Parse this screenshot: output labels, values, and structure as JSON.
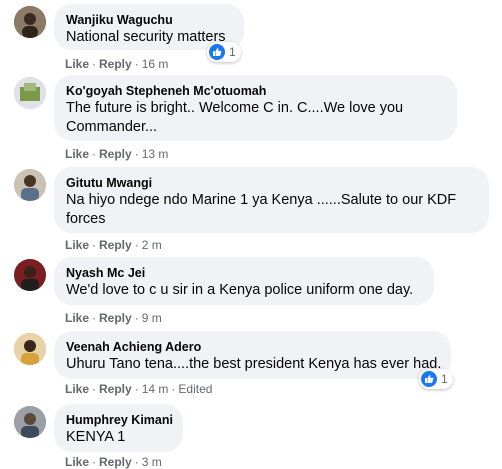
{
  "colors": {
    "bubble": "#f0f2f5",
    "meta": "#65676b",
    "like_blue": "#1877f2"
  },
  "actions": {
    "like": "Like",
    "reply": "Reply",
    "dot": "·"
  },
  "comments": [
    {
      "author": "Wanjiku Waguchu",
      "text": "National security matters",
      "time": "16 m",
      "edited": "",
      "reaction_icon": "like-icon",
      "reaction_count": "1"
    },
    {
      "author": "Ko'goyah Stepheneh Mc'otuomah",
      "text": "The future is bright.. Welcome C in. C....We love you Commander...",
      "time": "13 m",
      "edited": ""
    },
    {
      "author": "Gitutu Mwangi",
      "text": "Na hiyo ndege ndo Marine 1 ya Kenya ......Salute to our KDF forces",
      "time": "2 m",
      "edited": ""
    },
    {
      "author": "Nyash Mc Jei",
      "text": "We'd love to c u sir in a Kenya police uniform one day.",
      "time": "9 m",
      "edited": ""
    },
    {
      "author": "Veenah Achieng Adero",
      "text": "Uhuru Tano tena....the best president Kenya has ever had.",
      "time": "14 m",
      "edited": "Edited",
      "reaction_icon": "like-icon",
      "reaction_count": "1"
    },
    {
      "author": "Humphrey Kimani",
      "text": "KENYA 1",
      "time": "3 m",
      "edited": ""
    }
  ]
}
